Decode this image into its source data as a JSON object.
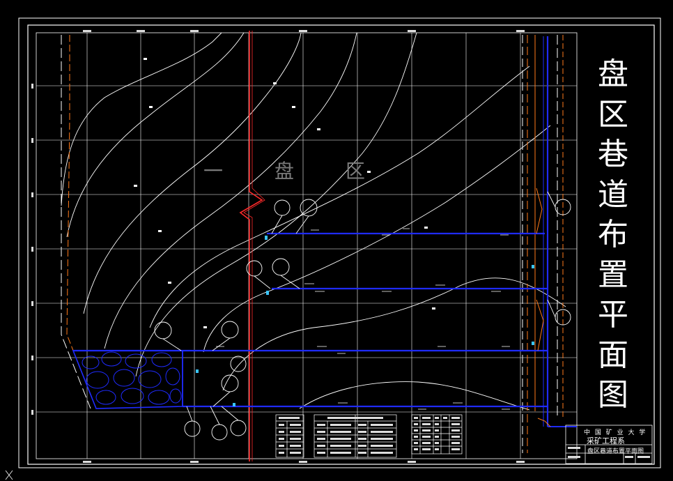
{
  "drawing_title": "盘区巷道布置平面图",
  "zone_label": [
    "一",
    "盘",
    "区"
  ],
  "title_block": {
    "school": "中 国 矿 业 大 学",
    "department": "采矿工程系",
    "drawing_name": "盘区巷道布置平面图"
  },
  "colors": {
    "background": "#000000",
    "frame": "#ffffff",
    "grid": "#ffffff",
    "contours": "#ffffff",
    "roadway": "#1f2bff",
    "boundary_fault": "#ff2a2a",
    "coal_pillar": "#ff7a1a",
    "zone_label": "#7a7a7a"
  }
}
